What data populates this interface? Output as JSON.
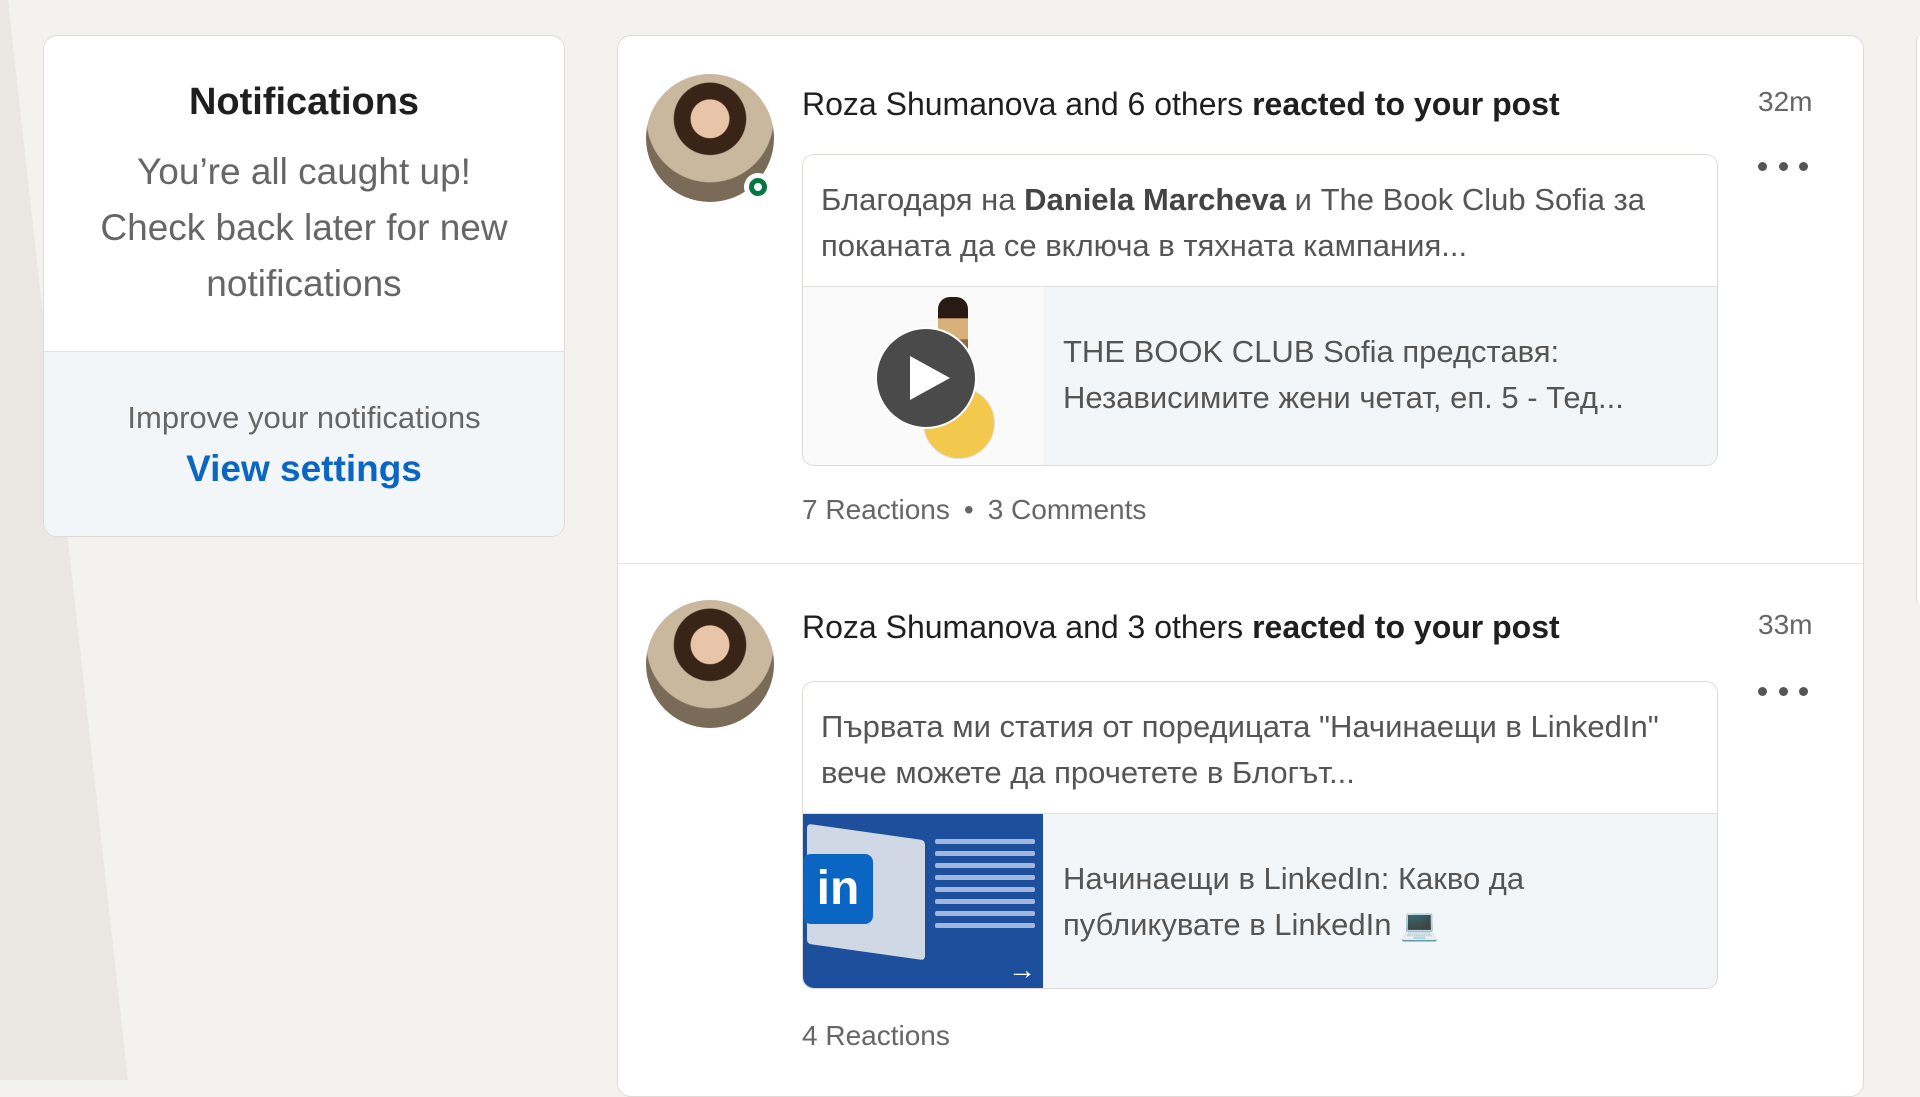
{
  "sidebar": {
    "title": "Notifications",
    "caught_up_message": "You’re all caught up! Check back later for new notifications",
    "improve_label": "Improve your notifications",
    "view_settings_label": "View settings"
  },
  "notifications": [
    {
      "actor": "Roza Shumanova",
      "others_text": "and 6 others",
      "action": "reacted to your post",
      "time": "32m",
      "online": true,
      "post_text_before": "Благодаря на",
      "post_text_bold": "Daniela Marcheva",
      "post_text_after": "и The Book Club Sofia за поканата да се включа в тяхната кампания...",
      "attachment_type": "video",
      "attachment_title": "THE BOOK CLUB Sofia представя: Независимите жени четат, еп. 5 - Тед...",
      "reactions": "7 Reactions",
      "comments": "3 Comments",
      "separator": "•",
      "menu_icon": "more-horizontal-icon"
    },
    {
      "actor": "Roza Shumanova",
      "others_text": "and 3 others",
      "action": "reacted to your post",
      "time": "33m",
      "online": false,
      "post_text": "Първата ми статия от поредицата \"Начинаещи в LinkedIn\" вече можете да прочетете в Блогът...",
      "attachment_type": "article",
      "attachment_title": "Начинаещи в LinkedIn: Какво да публикувате в LinkedIn 💻",
      "reactions": "4 Reactions",
      "menu_icon": "more-horizontal-icon"
    }
  ],
  "colors": {
    "accent": "#0a66c2",
    "online": "#057642",
    "page_bg": "#f4f2ee"
  }
}
